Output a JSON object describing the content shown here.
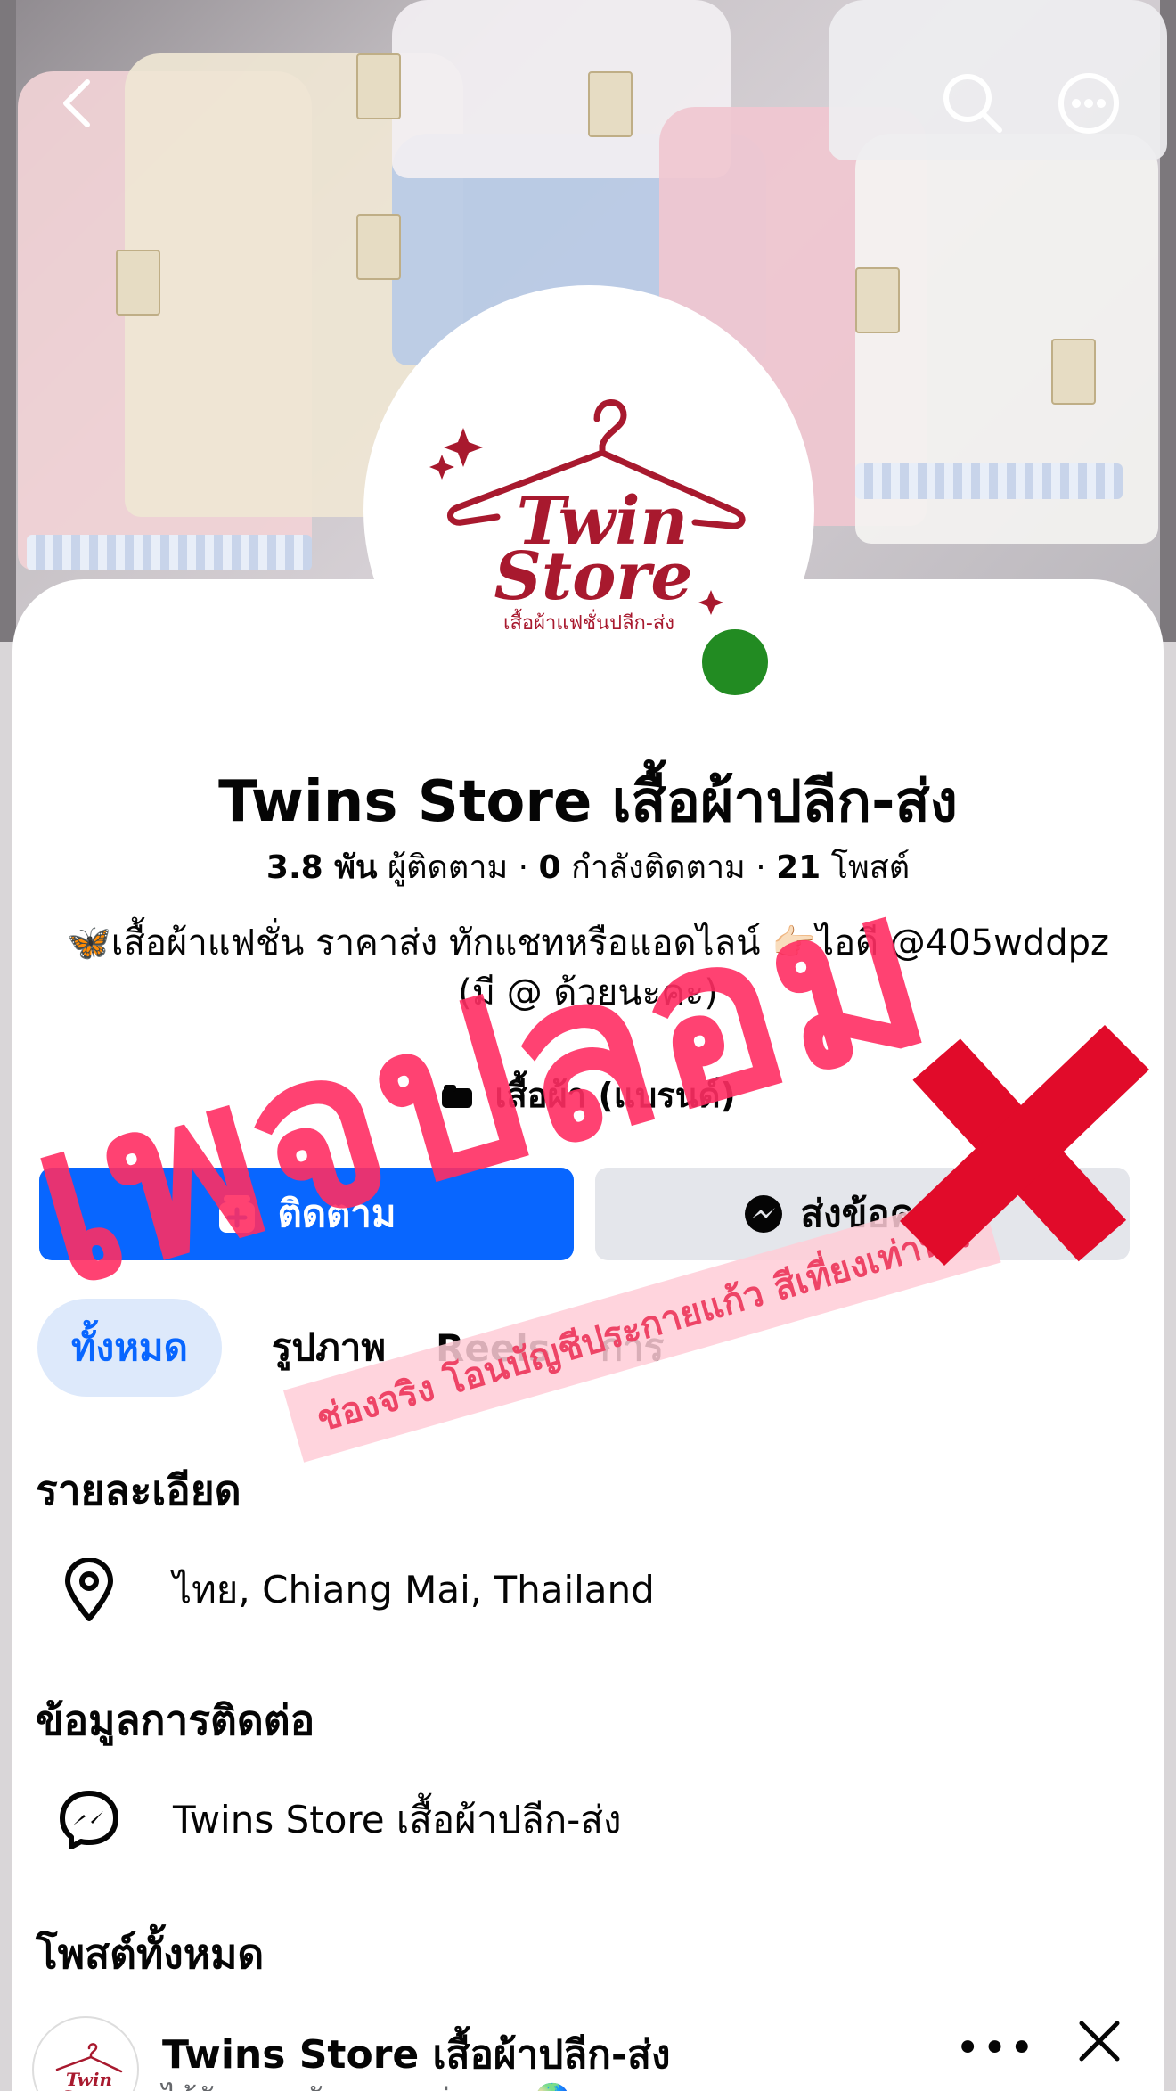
{
  "header": {
    "back_icon": "chevron-left-icon",
    "search_icon": "search-icon",
    "more_icon": "more-dots-icon"
  },
  "profile": {
    "logo_text_line1": "Twin",
    "logo_text_line2": "Store",
    "logo_tagline": "เสื้อผ้าแฟชั่นปลีก-ส่ง",
    "name": "Twins Store เสื้อผ้าปลีก-ส่ง",
    "followers_count": "3.8 พัน",
    "followers_label": "ผู้ติดตาม",
    "following_count": "0",
    "following_label": "กำลังติดตาม",
    "posts_count": "21",
    "posts_label": "โพสต์",
    "bio_line1": "🦋เสื้อผ้าแฟชั่น ราคาส่ง ทักแชทหรือแอดไลน์ 👉🏻ไอดี @405wddpz",
    "bio_line2": "(มี @ ด้วยนะคะ)",
    "category": "เสื้อผ้า (แบรนด์)"
  },
  "actions": {
    "follow_label": "ติดตาม",
    "message_label": "ส่งข้อความ"
  },
  "tabs": [
    {
      "label": "ทั้งหมด",
      "active": true
    },
    {
      "label": "รูปภาพ",
      "active": false
    },
    {
      "label": "Reels",
      "active": false
    },
    {
      "label": "การ",
      "active": false
    }
  ],
  "details": {
    "title": "รายละเอียด",
    "location": "ไทย, Chiang Mai, Thailand"
  },
  "contact": {
    "title": "ข้อมูลการติดต่อ",
    "messenger_name": "Twins Store เสื้อผ้าปลีก-ส่ง"
  },
  "posts": {
    "title": "โพสต์ทั้งหมด",
    "post_author": "Twins Store เสื้อผ้าปลีก-ส่ง",
    "post_sub": "ได้รับการสนับสนุน · ล่าสุด · 🌏",
    "more_label": "•••"
  },
  "overlay": {
    "stamp_text": "เพจปลอม",
    "note_text": "ช่องจริง โอนบัญชีประกายแก้ว  สีเที่ยงเท่านั้น"
  },
  "colors": {
    "fb_blue": "#0866ff",
    "online_green": "#228b22",
    "stamp_pink": "#ff2e63",
    "logo_red": "#a8192e"
  }
}
